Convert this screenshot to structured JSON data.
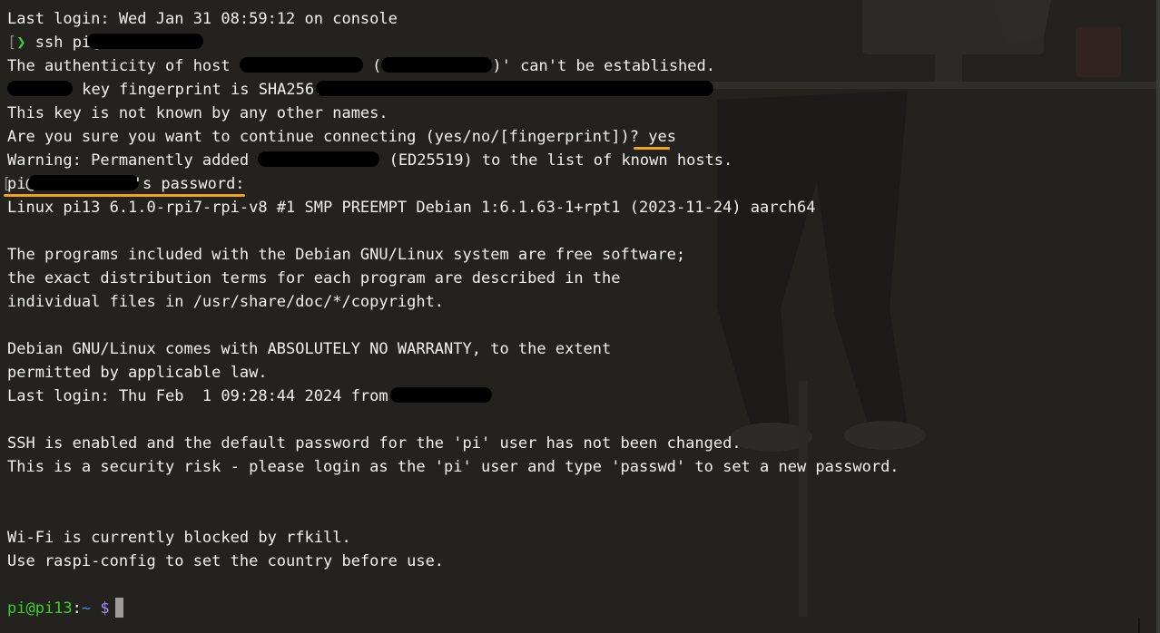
{
  "terminal": {
    "line1": "Last login: Wed Jan 31 08:59:12 on console",
    "ssh_prompt_arrow": "❯",
    "ssh_command": "ssh pi@",
    "authenticity_prefix": "The authenticity of host ",
    "authenticity_suffix": ")' can't be established.",
    "fingerprint_text": " key fingerprint is SHA256:",
    "unknown_key": "This key is not known by any other names.",
    "continue_question": "Are you sure you want to continue connecting (yes/no/[fingerprint])? ",
    "continue_answer": "yes",
    "warning_prefix": "Warning: Permanently added ",
    "warning_suffix": " (ED25519) to the list of known hosts.",
    "password_prefix": "pi@",
    "password_suffix": "'s password:",
    "uname": "Linux pi13 6.1.0-rpi7-rpi-v8 #1 SMP PREEMPT Debian 1:6.1.63-1+rpt1 (2023-11-24) aarch64",
    "motd1": "The programs included with the Debian GNU/Linux system are free software;",
    "motd2": "the exact distribution terms for each program are described in the",
    "motd3": "individual files in /usr/share/doc/*/copyright.",
    "motd4": "Debian GNU/Linux comes with ABSOLUTELY NO WARRANTY, to the extent",
    "motd5": "permitted by applicable law.",
    "last_login2": "Last login: Thu Feb  1 09:28:44 2024 from ",
    "ssh_warn1": "SSH is enabled and the default password for the 'pi' user has not been changed.",
    "ssh_warn2": "This is a security risk - please login as the 'pi' user and type 'passwd' to set a new password.",
    "wifi1": "Wi-Fi is currently blocked by rfkill.",
    "wifi2": "Use raspi-config to set the country before use.",
    "prompt_user": "pi@pi13",
    "prompt_sep": ":",
    "prompt_path": "~",
    "prompt_dollar": "$"
  },
  "colors": {
    "background": "#23221f",
    "text": "#f2f2ee",
    "prompt_user": "#3ccf2a",
    "prompt_path": "#3b8eea",
    "prompt_dollar": "#a78bfa",
    "highlight": "#f0a21a",
    "redaction": "#000000"
  }
}
